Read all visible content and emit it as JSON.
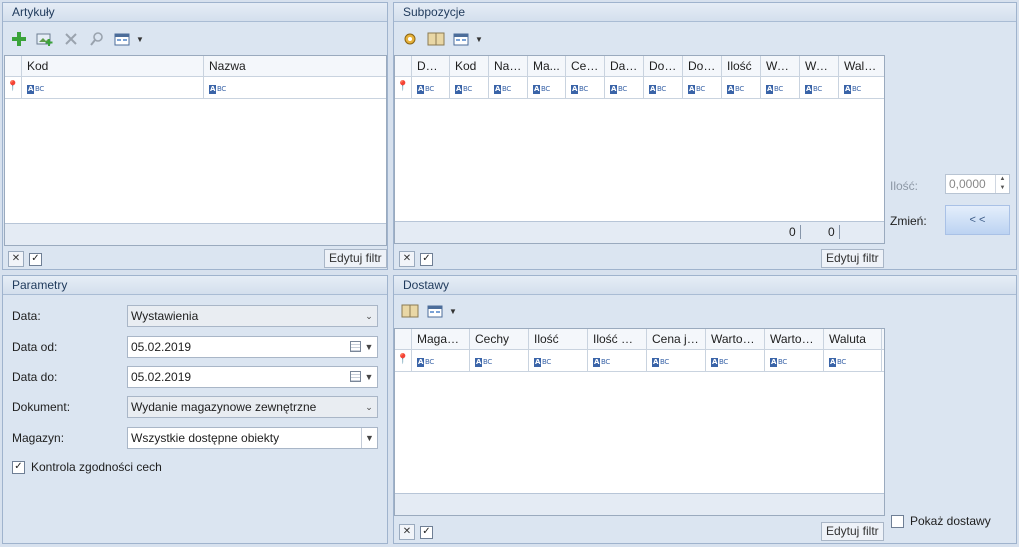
{
  "artykuly": {
    "title": "Artykuły",
    "columns": [
      "Kod",
      "Nazwa"
    ],
    "filter_label": "Edytuj filtr"
  },
  "subpozycje": {
    "title": "Subpozycje",
    "columns": [
      "Dok...",
      "Kod",
      "Naz...",
      "Ma...",
      "Cechy",
      "Dat...",
      "Dok...",
      "Dok...",
      "Ilość",
      "War...",
      "War...",
      "Waluta"
    ],
    "footer_values": [
      "0",
      "0"
    ],
    "filter_label": "Edytuj filtr"
  },
  "side": {
    "ilosc_label": "Ilość:",
    "ilosc_value": "0,0000",
    "zmien_label": "Zmień:",
    "zmien_button": "< <"
  },
  "parametry": {
    "title": "Parametry",
    "data_label": "Data:",
    "data_value": "Wystawienia",
    "data_od_label": "Data od:",
    "data_od_value": "05.02.2019",
    "data_do_label": "Data do:",
    "data_do_value": "05.02.2019",
    "dokument_label": "Dokument:",
    "dokument_value": "Wydanie magazynowe zewnętrzne",
    "magazyn_label": "Magazyn:",
    "magazyn_value": "Wszystkie dostępne obiekty",
    "kontrola_label": "Kontrola zgodności cech"
  },
  "dostawy": {
    "title": "Dostawy",
    "columns": [
      "Magazyn",
      "Cechy",
      "Ilość",
      "Ilość w j...",
      "Cena je...",
      "Wartość...",
      "Wartość...",
      "Waluta"
    ],
    "filter_label": "Edytuj filtr",
    "pokaz_label": "Pokaż dostawy"
  },
  "icons": {
    "abc_glyph": "ABC",
    "accent": "#3a64a8"
  }
}
